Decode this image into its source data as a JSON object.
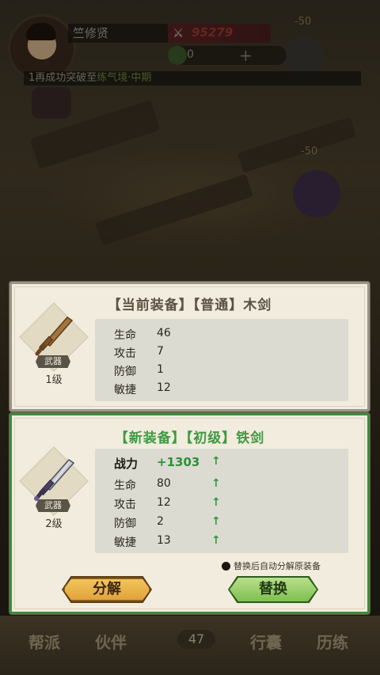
{
  "top_hud": {
    "player_name": "竺修贤",
    "combat_power": "95279",
    "currency_value": "0",
    "broadcast_prefix": "1",
    "broadcast_text": "再成功突破至",
    "broadcast_highlight": "练气境·中期",
    "damage_numbers": [
      "-50",
      "-50"
    ]
  },
  "current_equipment": {
    "title": "【当前装备】【普通】木剑",
    "type_tag": "武器",
    "level": "1级",
    "stats": [
      {
        "label": "生命",
        "value": "46"
      },
      {
        "label": "攻击",
        "value": "7"
      },
      {
        "label": "防御",
        "value": "1"
      },
      {
        "label": "敏捷",
        "value": "12"
      }
    ]
  },
  "new_equipment": {
    "title": "【新装备】【初级】铁剑",
    "type_tag": "武器",
    "level": "2级",
    "power_label": "战力",
    "power_value": "+1303",
    "arrow": "↑",
    "stats": [
      {
        "label": "生命",
        "value": "80"
      },
      {
        "label": "攻击",
        "value": "12"
      },
      {
        "label": "防御",
        "value": "2"
      },
      {
        "label": "敏捷",
        "value": "13"
      }
    ],
    "auto_note": "替换后自动分解原装备",
    "decompose_label": "分解",
    "replace_label": "替换"
  },
  "bottom_nav": {
    "items": [
      "帮派",
      "伙伴",
      "行囊",
      "历练"
    ],
    "badge": "47"
  },
  "colors": {
    "new_accent": "#3f8a3c",
    "gain_green": "#2f8f36",
    "panel_bg": "#f1ecdd"
  }
}
